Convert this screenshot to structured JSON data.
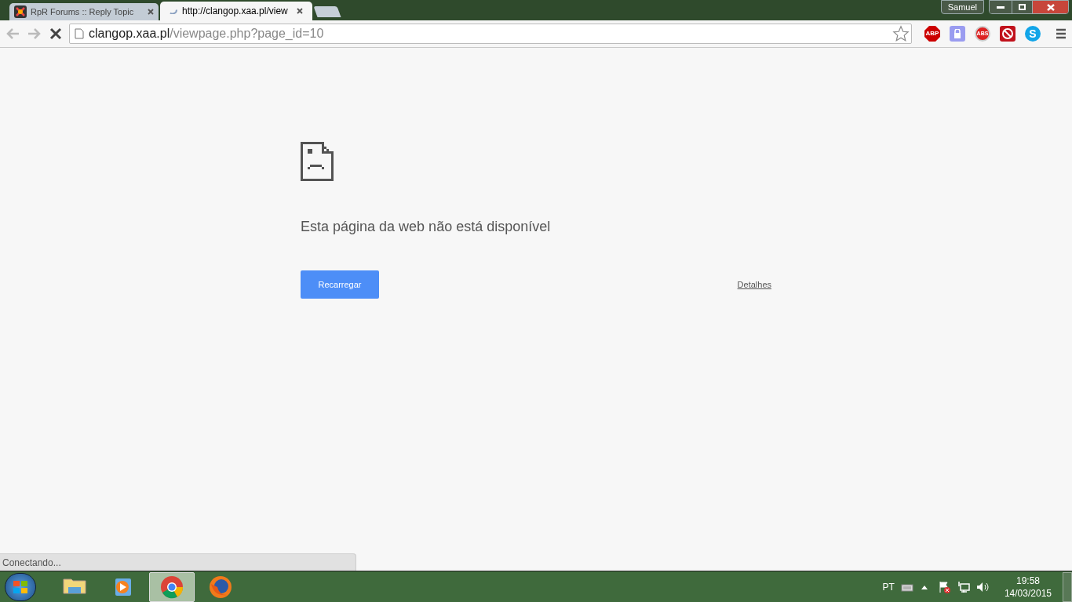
{
  "tabs": [
    {
      "title": "RpR Forums :: Reply Topic",
      "selected": false,
      "loading": false
    },
    {
      "title": "http://clangop.xaa.pl/view",
      "selected": true,
      "loading": true
    }
  ],
  "profile": {
    "name": "Samuel"
  },
  "toolbar": {
    "loading": true,
    "address_host": "clangop.xaa.pl",
    "address_path": "/viewpage.php?page_id=10"
  },
  "extensions": [
    {
      "kind": "abp",
      "label": "ABP"
    },
    {
      "kind": "lock"
    },
    {
      "kind": "abs",
      "label": "ABS"
    },
    {
      "kind": "blocked"
    },
    {
      "kind": "skype",
      "label": "S"
    }
  ],
  "error": {
    "title": "Esta página da web não está disponível",
    "button": "Recarregar",
    "details": "Detalhes"
  },
  "status_text": "Conectando...",
  "taskbar": {
    "apps": [
      {
        "kind": "folder",
        "selected": false
      },
      {
        "kind": "media",
        "selected": false
      },
      {
        "kind": "chrome",
        "selected": true
      },
      {
        "kind": "firefox",
        "selected": false
      }
    ],
    "language": "PT",
    "time": "19:58",
    "date": "14/03/2015"
  }
}
